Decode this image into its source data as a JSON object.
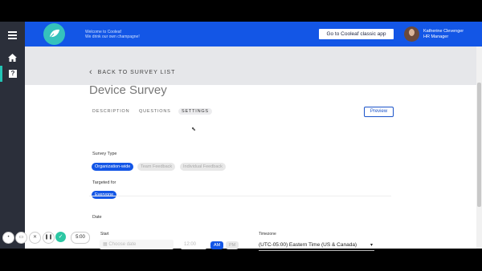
{
  "header": {
    "welcome_line1": "Welcome to Cooleaf",
    "welcome_line2": "We drink our own champagne!",
    "classic_button": "Go to Cooleaf classic app",
    "user_name": "Katherine Clevenger",
    "user_role": "HR Manager"
  },
  "nav": {
    "back": "BACK TO SURVEY LIST"
  },
  "survey": {
    "title": "Device Survey",
    "tabs": [
      "DESCRIPTION",
      "QUESTIONS",
      "SETTINGS"
    ],
    "active_tab": "SETTINGS",
    "preview": "Preview",
    "survey_type_label": "Survey Type",
    "survey_types": [
      "Organization-wide",
      "Team Feedback",
      "Individual Feedback"
    ],
    "targeted_label": "Targeted for",
    "targeted_value": "Everyone",
    "date_label": "Date",
    "start_label": "Start",
    "date_placeholder": "Choose date",
    "time_placeholder": "12:00",
    "am": "AM",
    "pm": "PM",
    "timezone_label": "Timezone",
    "timezone_value": "(UTC-05:00) Eastern Time (US & Canada)"
  },
  "recorder": {
    "time": "5:00"
  },
  "colors": {
    "brand_blue": "#1356e6",
    "accent_teal": "#23c4b5",
    "sidebar_dark": "#2b2f3a"
  }
}
